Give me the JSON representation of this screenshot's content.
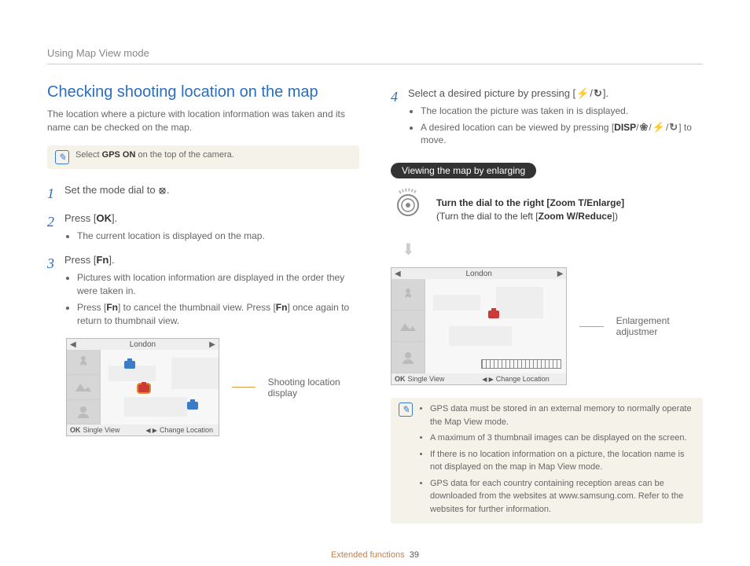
{
  "breadcrumb": "Using Map View mode",
  "title": "Checking shooting location on the map",
  "intro": "The location where a picture with location information was taken and its name can be checked on the map.",
  "note1_pre": "Select ",
  "note1_bold": "GPS ON",
  "note1_post": " on the top of the camera.",
  "step1_pre": "Set the mode dial to ",
  "step1_post": ".",
  "step2_pre": "Press [",
  "step2_icon": "OK",
  "step2_post": "].",
  "step2_b1": "The current location is displayed on the map.",
  "step3_pre": "Press [",
  "step3_icon": "Fn",
  "step3_post": "].",
  "step3_b1": "Pictures with location information are displayed in the order they were taken in.",
  "step3_b2_a": "Press [",
  "step3_b2_b": "] to cancel the thumbnail view. Press [",
  "step3_b2_c": "] once again to return to thumbnail view.",
  "map_city": "London",
  "map_footer_single": "Single View",
  "map_footer_change": "Change Location",
  "callout1": "Shooting location display",
  "step4_pre": "Select a desired picture by pressing [",
  "step4_mid": "/",
  "step4_post": "].",
  "step4_b1": "The location the picture was taken in is displayed.",
  "step4_b2_a": "A desired location can be viewed by pressing [",
  "step4_b2_b": "] to move.",
  "disp_icon": "DISP",
  "pill": "Viewing the map by enlarging",
  "dial_line1_pre": "Turn the dial to the right [",
  "dial_line1_bold": "Zoom T/Enlarge",
  "dial_line1_post": "]",
  "dial_line2_pre": "(Turn the dial to the left [",
  "dial_line2_bold": "Zoom W/Reduce",
  "dial_line2_post": "])",
  "callout2": "Enlargement adjustmer",
  "note2_b1": "GPS data must be stored in an external memory to normally operate the Map View mode.",
  "note2_b2": "A maximum of 3 thumbnail images can be displayed on the screen.",
  "note2_b3": "If there is no location information on a picture, the location name is not displayed on the map in Map View mode.",
  "note2_b4": "GPS data for each country containing reception areas can be downloaded from the websites at www.samsung.com. Refer to the websites for further information.",
  "footer_label": "Extended functions",
  "footer_page": "39"
}
